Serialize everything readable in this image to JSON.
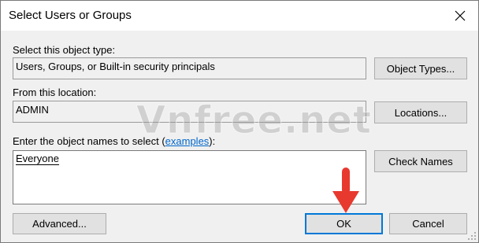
{
  "window": {
    "title": "Select Users or Groups"
  },
  "object_type": {
    "label": "Select this object type:",
    "value": "Users, Groups, or Built-in security principals",
    "button": "Object Types..."
  },
  "location": {
    "label": "From this location:",
    "value": "ADMIN",
    "button": "Locations..."
  },
  "names": {
    "label_prefix": "Enter the object names to select (",
    "label_link": "examples",
    "label_suffix": "):",
    "value": "Everyone",
    "button": "Check Names"
  },
  "buttons": {
    "advanced": "Advanced...",
    "ok": "OK",
    "cancel": "Cancel"
  },
  "watermark": "Vnfree.net",
  "colors": {
    "annotation_arrow": "#e8392f",
    "default_button_border": "#0078d7",
    "link": "#0066cc"
  }
}
